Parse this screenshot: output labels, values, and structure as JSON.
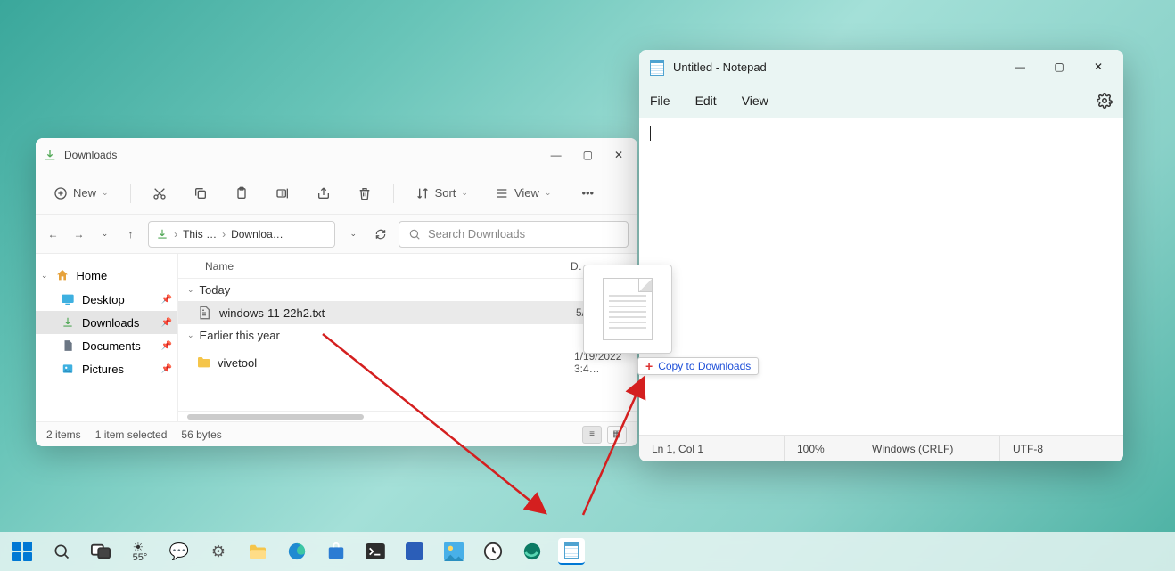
{
  "explorer": {
    "title": "Downloads",
    "toolbar": {
      "new": "New",
      "sort": "Sort",
      "view": "View"
    },
    "addr": {
      "crumb1": "This …",
      "crumb2": "Downloa…"
    },
    "search_placeholder": "Search Downloads",
    "side": {
      "home": "Home",
      "desktop": "Desktop",
      "downloads": "Downloads",
      "documents": "Documents",
      "pictures": "Pictures"
    },
    "cols": {
      "name": "Name",
      "date": "D…"
    },
    "groups": {
      "today": "Today",
      "earlier": "Earlier this year"
    },
    "files": {
      "f1": {
        "name": "windows-11-22h2.txt",
        "date": "5/…"
      },
      "f2": {
        "name": "vivetool",
        "date": "1/19/2022 3:4…"
      }
    },
    "status": {
      "count": "2 items",
      "selected": "1 item selected",
      "size": "56 bytes"
    }
  },
  "notepad": {
    "title": "Untitled - Notepad",
    "menu": {
      "file": "File",
      "edit": "Edit",
      "view": "View"
    },
    "status": {
      "pos": "Ln 1, Col 1",
      "zoom": "100%",
      "crlf": "Windows (CRLF)",
      "enc": "UTF-8"
    }
  },
  "drag": {
    "label": "Copy to Downloads"
  },
  "taskbar": {
    "temp": "55°"
  }
}
